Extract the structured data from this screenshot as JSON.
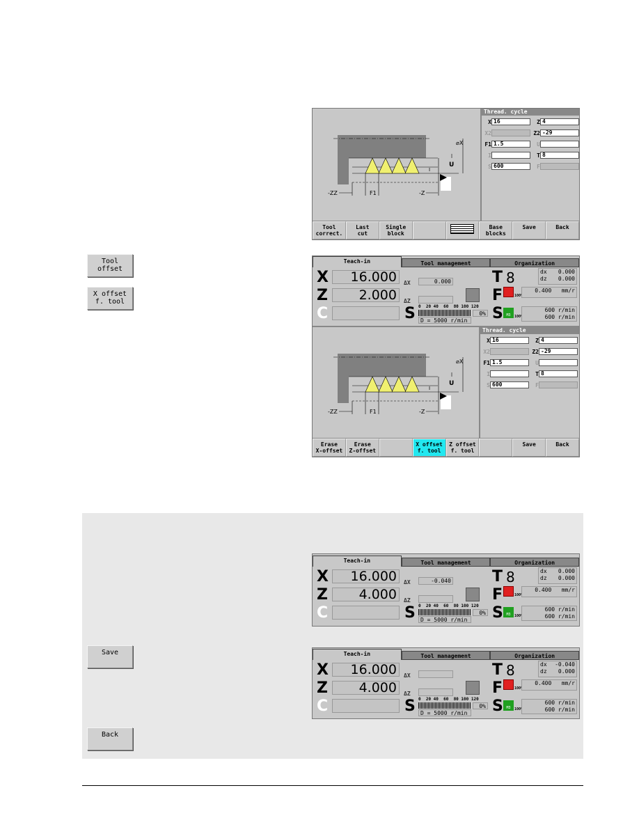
{
  "side_buttons": {
    "tool_offset": "Tool\noffset",
    "x_offset": "X offset\nf. tool",
    "save": "Save",
    "back": "Back"
  },
  "panel1": {
    "form_title": "Thread. cycle",
    "fields": [
      {
        "l": "X",
        "v": "16"
      },
      {
        "l": "Z",
        "v": "4"
      },
      {
        "l": "X2",
        "v": "",
        "dis": true
      },
      {
        "l": "Z2",
        "v": "-29"
      },
      {
        "l": "F1",
        "v": "1.5"
      },
      {
        "l": "U",
        "v": "",
        "dim": true
      },
      {
        "l": "I",
        "v": "",
        "dim": true
      },
      {
        "l": "T",
        "v": "8"
      },
      {
        "l": "S",
        "v": "600",
        "dim": true
      },
      {
        "l": "F",
        "v": "",
        "dis": true,
        "dim": true
      }
    ],
    "softkeys": [
      "Tool\ncorrect.",
      "Last\ncut",
      "Single\nblock",
      "",
      "[icon]",
      "Base\nblocks",
      "Save",
      "Back"
    ]
  },
  "panel2": {
    "status": {
      "tabs": [
        "Teach-in",
        "Tool management",
        "Organization"
      ],
      "x": "16.000",
      "z": "2.000",
      "dx_field": "0.000",
      "dz_field": "",
      "t": "8",
      "t_dx": "0.000",
      "t_dz": "0.000",
      "feed": "0.400",
      "feed_unit": "mm/r",
      "feed_pct": "100%",
      "spindle_set": "600",
      "spindle_act": "600",
      "speed_unit": "r/min",
      "sp_pct": "100%",
      "m_code": "M3",
      "scale": "0  20 40  60  80 100 120",
      "load": "0%",
      "dmax": "D =  5000 r/min"
    },
    "form_title": "Thread. cycle",
    "fields": [
      {
        "l": "X",
        "v": "16"
      },
      {
        "l": "Z",
        "v": "4"
      },
      {
        "l": "X2",
        "v": "",
        "dis": true
      },
      {
        "l": "Z2",
        "v": "-29"
      },
      {
        "l": "F1",
        "v": "1.5"
      },
      {
        "l": "U",
        "v": "",
        "dim": true
      },
      {
        "l": "I",
        "v": "",
        "dim": true
      },
      {
        "l": "T",
        "v": "8"
      },
      {
        "l": "S",
        "v": "600",
        "dim": true
      },
      {
        "l": "F",
        "v": "",
        "dis": true,
        "dim": true
      }
    ],
    "softkeys": [
      "Erase\nX-offset",
      "Erase\nZ-offset",
      "",
      "X offset\nf. tool",
      "Z offset\nf. tool",
      "",
      "Save",
      "Back"
    ],
    "active_softkey": 3
  },
  "panel3": {
    "status": {
      "tabs": [
        "Teach-in",
        "Tool management",
        "Organization"
      ],
      "x": "16.000",
      "z": "4.000",
      "dx_field": "-0.040",
      "dz_field": "",
      "t": "8",
      "t_dx": "0.000",
      "t_dz": "0.000",
      "feed": "0.400",
      "feed_unit": "mm/r",
      "feed_pct": "100%",
      "spindle_set": "600",
      "spindle_act": "600",
      "speed_unit": "r/min",
      "sp_pct": "100%",
      "m_code": "M3",
      "scale": "0  20 40  60  80 100 120",
      "load": "0%",
      "dmax": "D =  5000 r/min"
    }
  },
  "panel4": {
    "status": {
      "tabs": [
        "Teach-in",
        "Tool management",
        "Organization"
      ],
      "x": "16.000",
      "z": "4.000",
      "dx_field": "",
      "dz_field": "",
      "t": "8",
      "t_dx": "-0.040",
      "t_dz": "0.000",
      "feed": "0.400",
      "feed_unit": "mm/r",
      "feed_pct": "100%",
      "spindle_set": "600",
      "spindle_act": "600",
      "speed_unit": "r/min",
      "sp_pct": "100%",
      "m_code": "M3",
      "scale": "0  20 40  60  80 100 120",
      "load": "0%",
      "dmax": "D =  5000 r/min"
    }
  },
  "diagram_labels": {
    "zz": "-ZZ",
    "f1": "F1",
    "z": "-Z",
    "dx": "⌀X",
    "u": "U",
    "i": "I"
  },
  "colors": {
    "screen": "#c8c8c8",
    "thread": "#f0f070",
    "feed_icon": "#e02020",
    "spindle_icon": "#20a020",
    "active_softkey": "#22e8f0"
  }
}
